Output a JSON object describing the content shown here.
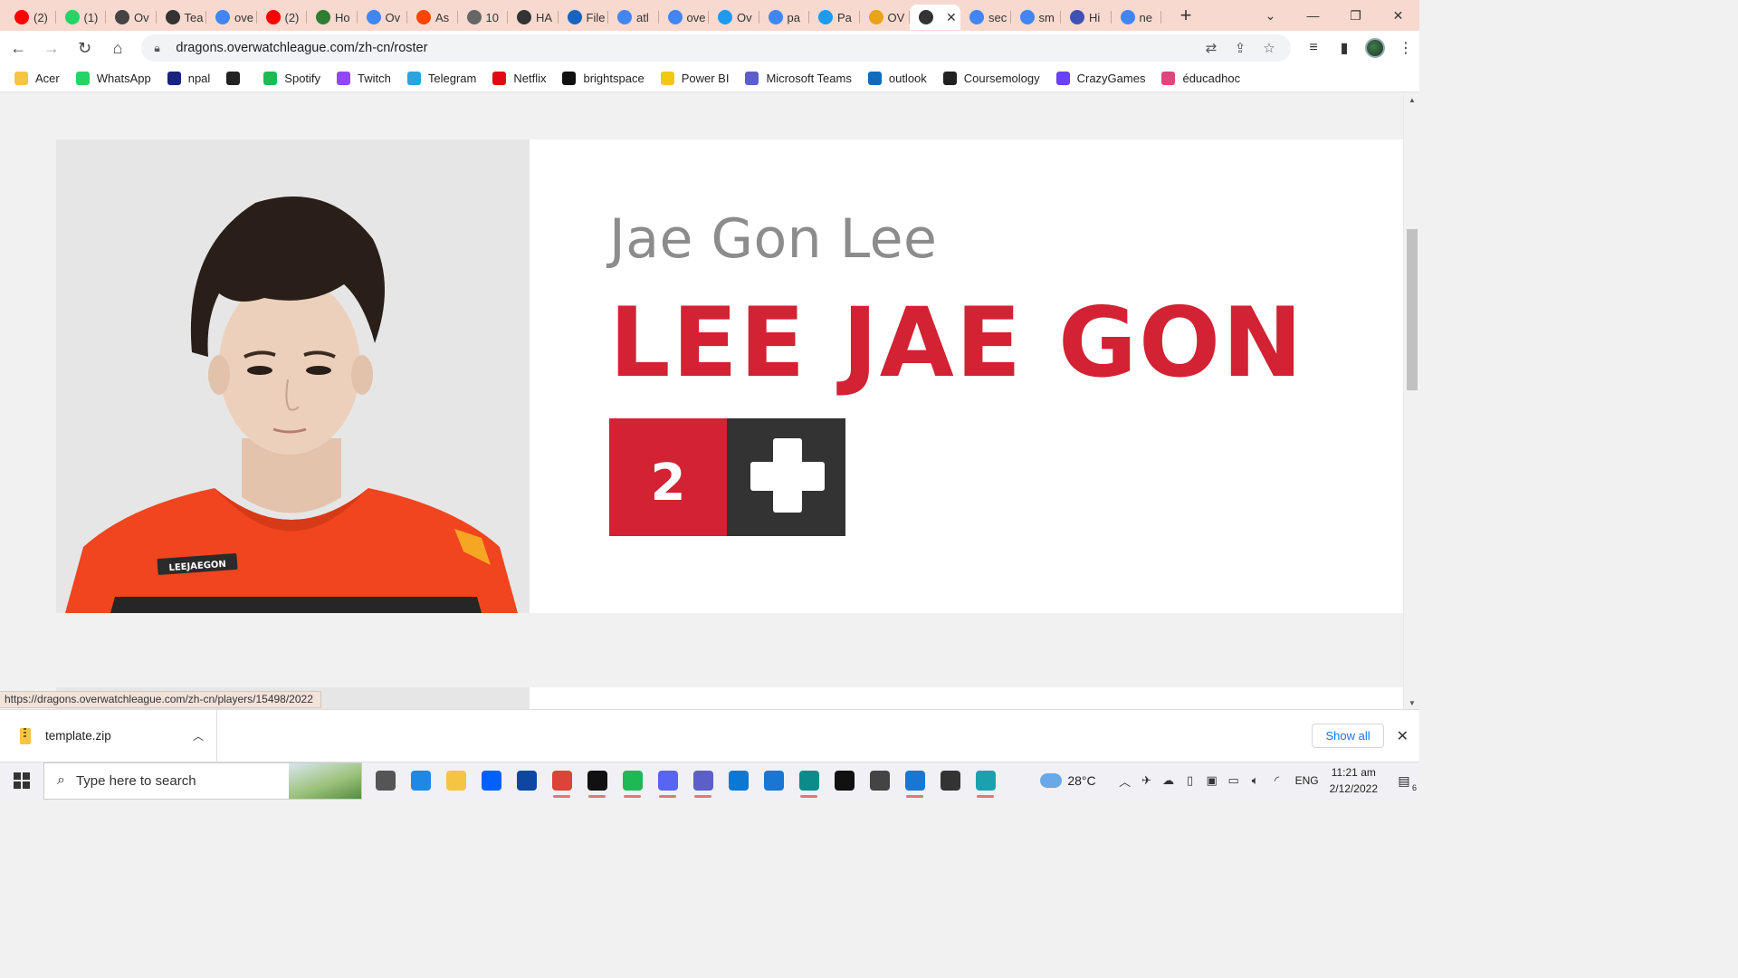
{
  "browser": {
    "tabs": [
      {
        "label": "(2)",
        "icon": "youtube-icon",
        "color": "#ff0000"
      },
      {
        "label": "(1)",
        "icon": "whatsapp-icon",
        "color": "#25d366"
      },
      {
        "label": "Ov",
        "icon": "overwatch-icon",
        "color": "#444444"
      },
      {
        "label": "Tea",
        "icon": "dragons-icon",
        "color": "#333333"
      },
      {
        "label": "ove",
        "icon": "google-icon",
        "color": "#4285f4"
      },
      {
        "label": "(2)",
        "icon": "youtube-icon",
        "color": "#ff0000"
      },
      {
        "label": "Ho",
        "icon": "wiki-icon",
        "color": "#2e7d32"
      },
      {
        "label": "Ov",
        "icon": "google-icon",
        "color": "#4285f4"
      },
      {
        "label": "As",
        "icon": "reddit-icon",
        "color": "#ff4500"
      },
      {
        "label": "10",
        "icon": "globe-icon",
        "color": "#666666"
      },
      {
        "label": "HA",
        "icon": "dragons-icon",
        "color": "#333333"
      },
      {
        "label": "File",
        "icon": "file-icon",
        "color": "#1565c0"
      },
      {
        "label": "atl",
        "icon": "google-icon",
        "color": "#4285f4"
      },
      {
        "label": "ove",
        "icon": "google-icon",
        "color": "#4285f4"
      },
      {
        "label": "Ov",
        "icon": "twitter-icon",
        "color": "#1d9bf0"
      },
      {
        "label": "pa",
        "icon": "google-icon",
        "color": "#4285f4"
      },
      {
        "label": "Pa",
        "icon": "twitter-icon",
        "color": "#1d9bf0"
      },
      {
        "label": "OV",
        "icon": "coin-icon",
        "color": "#e8a317"
      },
      {
        "label": "",
        "icon": "dragons-icon",
        "color": "#333333",
        "active": true
      },
      {
        "label": "sec",
        "icon": "google-icon",
        "color": "#4285f4"
      },
      {
        "label": "sm",
        "icon": "google-icon",
        "color": "#4285f4"
      },
      {
        "label": "Hi",
        "icon": "globe-icon",
        "color": "#3f51b5"
      },
      {
        "label": "ne",
        "icon": "google-icon",
        "color": "#4285f4"
      }
    ],
    "url": "dragons.overwatchleague.com/zh-cn/roster",
    "bookmarks": [
      {
        "label": "Acer",
        "icon": "folder-icon",
        "color": "#f5c542"
      },
      {
        "label": "WhatsApp",
        "icon": "whatsapp-icon",
        "color": "#25d366"
      },
      {
        "label": "npal",
        "icon": "npal-icon",
        "color": "#1a237e"
      },
      {
        "label": "",
        "icon": "globe-icon",
        "color": "#222222"
      },
      {
        "label": "Spotify",
        "icon": "spotify-icon",
        "color": "#1db954"
      },
      {
        "label": "Twitch",
        "icon": "twitch-icon",
        "color": "#9146ff"
      },
      {
        "label": "Telegram",
        "icon": "telegram-icon",
        "color": "#2aa3df"
      },
      {
        "label": "Netflix",
        "icon": "netflix-icon",
        "color": "#e50914"
      },
      {
        "label": "brightspace",
        "icon": "np-icon",
        "color": "#111111"
      },
      {
        "label": "Power BI",
        "icon": "powerbi-icon",
        "color": "#f2c811"
      },
      {
        "label": "Microsoft Teams",
        "icon": "teams-icon",
        "color": "#5b5fc7"
      },
      {
        "label": "outlook",
        "icon": "outlook-icon",
        "color": "#0f6cbd"
      },
      {
        "label": "Coursemology",
        "icon": "coursemology-icon",
        "color": "#222222"
      },
      {
        "label": "CrazyGames",
        "icon": "crazygames-icon",
        "color": "#6842ff"
      },
      {
        "label": "éducadhoc",
        "icon": "educadhoc-icon",
        "color": "#e0457b"
      }
    ]
  },
  "player": {
    "name_small": "Jae Gon Lee",
    "name_big": "LEE JAE GON",
    "number": "2",
    "role_icon": "support-cross-icon",
    "photo_jersey_text": "LEEJAEGON",
    "colors": {
      "accent": "#d22233",
      "role_bg": "#333333",
      "name_small": "#8c8c8c"
    }
  },
  "status_url": "https://dragons.overwatchleague.com/zh-cn/players/15498/2022",
  "download": {
    "filename": "template.zip",
    "show_all": "Show all"
  },
  "taskbar": {
    "search_placeholder": "Type here to search",
    "apps": [
      "task-view-icon",
      "mail-icon",
      "file-explorer-icon",
      "dropbox-icon",
      "app-icon",
      "chrome-icon",
      "netflix-icon",
      "spotify-icon",
      "discord-icon",
      "teams-icon",
      "vscode-icon",
      "photos-icon",
      "edge-icon",
      "pycharm-icon",
      "unity-icon",
      "m-app-icon",
      "unity-hub-icon",
      "edge-beta-icon"
    ],
    "temperature": "28°C",
    "language": "ENG",
    "time": "11:21 am",
    "date": "2/12/2022",
    "notification_count": "6"
  }
}
